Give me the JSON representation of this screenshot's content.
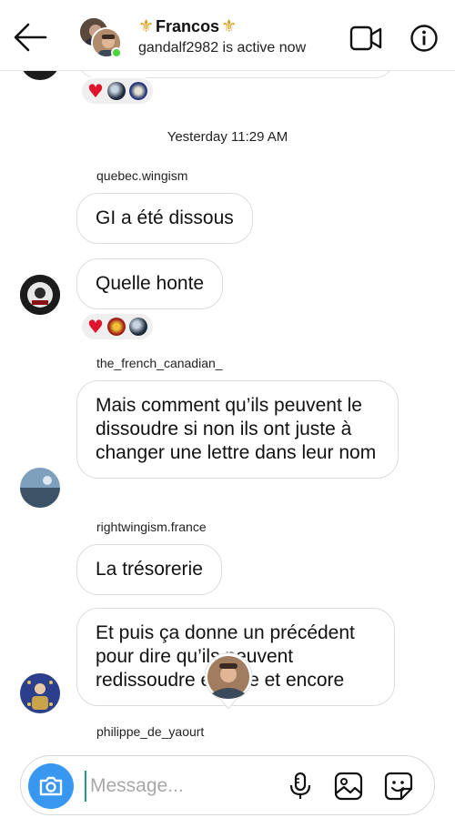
{
  "header": {
    "title": "Francos",
    "title_left_glyph": "⚜",
    "title_right_glyph": "⚜",
    "status": "gandalf2982 is active now"
  },
  "thread": {
    "timestamp": "Yesterday 11:29 AM",
    "messages": [
      {
        "username": "quebec.wingism",
        "text": "GI a été dissous"
      },
      {
        "username": "",
        "text": "Quelle honte"
      },
      {
        "username": "the_french_canadian_",
        "text": "Mais comment qu’ils peuvent le dissoudre si non ils ont juste à changer une lettre dans leur nom"
      },
      {
        "username": "rightwingism.france",
        "text": "La trésorerie"
      },
      {
        "username": "",
        "text": "Et puis ça donne un précédent pour dire qu’ils peuvent redissoudre encore et encore"
      },
      {
        "username": "philippe_de_yaourt",
        "text": ""
      }
    ],
    "reaction_glyph": "♥"
  },
  "composer": {
    "placeholder": "Message..."
  },
  "colors": {
    "accent": "#3897f0",
    "online": "#4cd63f",
    "heart": "#e1142d",
    "fleur": "#d99a1c"
  },
  "icons": [
    "back-arrow-icon",
    "video-call-icon",
    "info-icon",
    "camera-icon",
    "microphone-icon",
    "gallery-icon",
    "sticker-icon"
  ]
}
